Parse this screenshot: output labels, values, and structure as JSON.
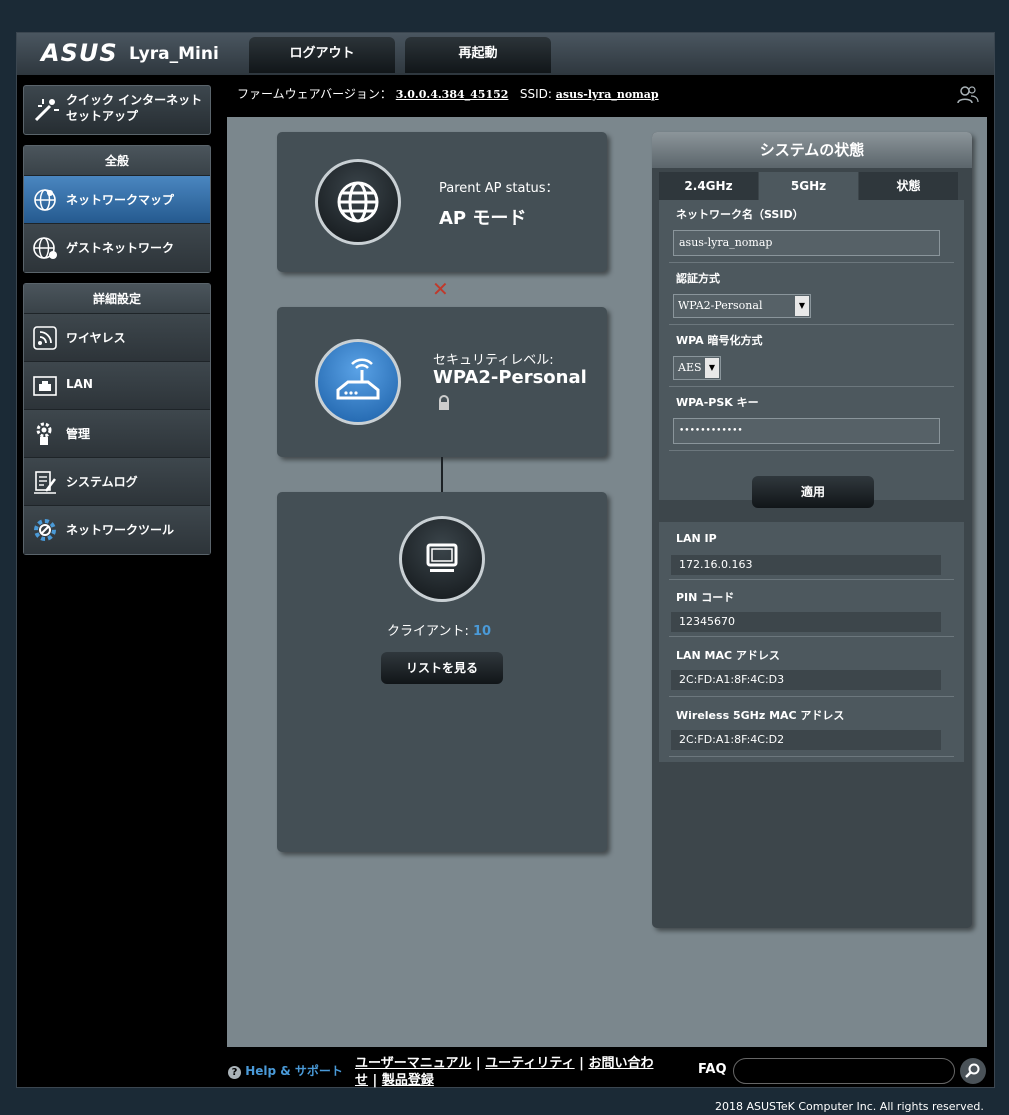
{
  "header": {
    "logo": "ASUS",
    "model": "Lyra_Mini",
    "logout_label": "ログアウト",
    "reboot_label": "再起動"
  },
  "firmware": {
    "label": "ファームウェアバージョン：",
    "version": "3.0.0.4.384_45152",
    "ssid_label": "SSID:",
    "ssid": "asus-lyra_nomap"
  },
  "sidebar": {
    "quick_setup": "クイック インターネット セットアップ",
    "general_header": "全般",
    "general_items": [
      {
        "label": "ネットワークマップ",
        "active": true
      },
      {
        "label": "ゲストネットワーク",
        "active": false
      }
    ],
    "advanced_header": "詳細設定",
    "advanced_items": [
      {
        "label": "ワイヤレス"
      },
      {
        "label": "LAN"
      },
      {
        "label": "管理"
      },
      {
        "label": "システムログ"
      },
      {
        "label": "ネットワークツール"
      }
    ]
  },
  "map": {
    "parent_ap_label": "Parent AP status：",
    "parent_ap_value": "AP モード",
    "security_label": "セキュリティレベル:",
    "security_value": "WPA2-Personal",
    "clients_label": "クライアント:",
    "clients_count": "10",
    "view_list_label": "リストを見る"
  },
  "system_status": {
    "title": "システムの状態",
    "tabs": [
      "2.4GHz",
      "5GHz",
      "状態"
    ],
    "active_tab": "5GHz",
    "ssid_label": "ネットワーク名（SSID）",
    "ssid_value": "asus-lyra_nomap",
    "auth_label": "認証方式",
    "auth_value": "WPA2-Personal",
    "enc_label": "WPA 暗号化方式",
    "enc_value": "AES",
    "psk_label": "WPA-PSK キー",
    "psk_value": "••••••••••••",
    "apply_label": "適用",
    "lan_ip_label": "LAN IP",
    "lan_ip": "172.16.0.163",
    "pin_label": "PIN コード",
    "pin": "12345670",
    "lan_mac_label": "LAN MAC アドレス",
    "lan_mac": "2C:FD:A1:8F:4C:D3",
    "wl_mac_label": "Wireless 5GHz MAC アドレス",
    "wl_mac": "2C:FD:A1:8F:4C:D2"
  },
  "footer": {
    "help": "Help & サポート",
    "links": [
      "ユーザーマニュアル",
      "ユーティリティ",
      "お問い合わせ",
      "製品登録"
    ],
    "faq": "FAQ",
    "copyright": "2018 ASUSTeK Computer Inc. All rights reserved."
  },
  "colors": {
    "accent": "#3c7bbd",
    "panel": "#7b878d",
    "card": "#444f55",
    "help_link": "#4a9ad8",
    "error_x": "#c0392b"
  }
}
